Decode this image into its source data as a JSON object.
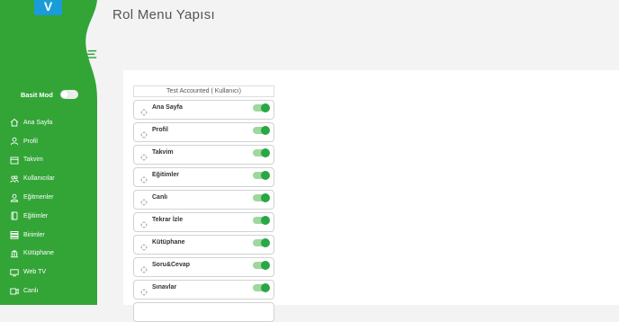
{
  "app": {
    "logo_text": "V",
    "brand_color": "#33a537",
    "logo_color": "#1a9cd8"
  },
  "header": {
    "title": "Rol Menu Yapısı"
  },
  "sidebar": {
    "simple_mode_label": "Basit Mod",
    "simple_mode_on": false,
    "items": [
      {
        "label": "Ana Sayfa",
        "icon": "home-icon"
      },
      {
        "label": "Profil",
        "icon": "user-icon"
      },
      {
        "label": "Takvim",
        "icon": "calendar-icon"
      },
      {
        "label": "Kullanıcılar",
        "icon": "users-icon"
      },
      {
        "label": "Eğitmenler",
        "icon": "instructor-icon"
      },
      {
        "label": "Eğitimler",
        "icon": "book-icon"
      },
      {
        "label": "Birimler",
        "icon": "units-icon"
      },
      {
        "label": "Kütüphane",
        "icon": "library-icon"
      },
      {
        "label": "Web TV",
        "icon": "tv-icon"
      },
      {
        "label": "Canlı",
        "icon": "live-icon"
      }
    ]
  },
  "role_panel": {
    "header": "Test Accounted ( Kullanıcı)",
    "items": [
      {
        "label": "Ana Sayfa",
        "enabled": true
      },
      {
        "label": "Profil",
        "enabled": true
      },
      {
        "label": "Takvim",
        "enabled": true
      },
      {
        "label": "Eğitimler",
        "enabled": true
      },
      {
        "label": "Canlı",
        "enabled": true
      },
      {
        "label": "Tekrar İzle",
        "enabled": true
      },
      {
        "label": "Kütüphane",
        "enabled": true
      },
      {
        "label": "Soru&Cevap",
        "enabled": true
      },
      {
        "label": "Sınavlar",
        "enabled": true
      }
    ]
  }
}
